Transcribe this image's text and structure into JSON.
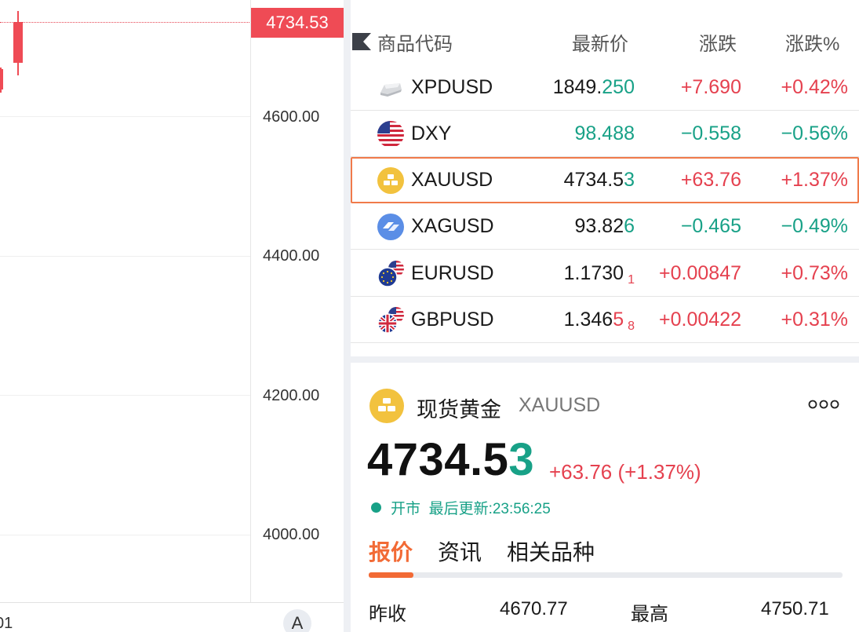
{
  "chart": {
    "current_price_tag": "4734.53",
    "y_axis_labels": [
      "4600.00",
      "4400.00",
      "4200.00",
      "4000.00"
    ],
    "x_axis_label": "01",
    "auto_button": "A",
    "colors": {
      "up": "#ef4b55",
      "grid": "#efefef"
    }
  },
  "watchlist": {
    "headers": {
      "symbol": "商品代码",
      "price": "最新价",
      "change": "涨跌",
      "change_pct": "涨跌%"
    },
    "rows": [
      {
        "icon": "palladium-icon",
        "symbol": "XPDUSD",
        "price_main": "1849.",
        "price_tail": "250",
        "price_tail_dir": "down",
        "price_sub": "",
        "change": "+7.690",
        "pct": "+0.42%",
        "dir": "up"
      },
      {
        "icon": "us-flag-icon",
        "symbol": "DXY",
        "price_main": "",
        "price_tail": "98.488",
        "price_tail_dir": "down",
        "price_sub": "",
        "change": "−0.558",
        "pct": "−0.56%",
        "dir": "down"
      },
      {
        "icon": "gold-icon",
        "symbol": "XAUUSD",
        "price_main": "4734.5",
        "price_tail": "3",
        "price_tail_dir": "down",
        "price_sub": "",
        "change": "+63.76",
        "pct": "+1.37%",
        "dir": "up",
        "selected": true
      },
      {
        "icon": "silver-icon",
        "symbol": "XAGUSD",
        "price_main": "93.82",
        "price_tail": "6",
        "price_tail_dir": "down",
        "price_sub": "",
        "change": "−0.465",
        "pct": "−0.49%",
        "dir": "down"
      },
      {
        "icon": "eu-us-flag-icon",
        "symbol": "EURUSD",
        "price_main": "1.1730",
        "price_tail": "",
        "price_tail_dir": "up",
        "price_sub": "1",
        "change": "+0.00847",
        "pct": "+0.73%",
        "dir": "up"
      },
      {
        "icon": "uk-us-flag-icon",
        "symbol": "GBPUSD",
        "price_main": "1.346",
        "price_tail": "5",
        "price_tail_dir": "up",
        "price_sub": "8",
        "change": "+0.00422",
        "pct": "+0.31%",
        "dir": "up"
      }
    ]
  },
  "detail": {
    "name": "现货黄金",
    "code": "XAUUSD",
    "price_main": "4734.5",
    "price_last": "3",
    "change": "+63.76 (+1.37%)",
    "status": "开市",
    "updated_label": "最后更新:23:56:25",
    "tabs": [
      "报价",
      "资讯",
      "相关品种"
    ],
    "active_tab": 0,
    "stats": {
      "prev_close_label": "昨收",
      "prev_close": "4670.77",
      "high_label": "最高",
      "high": "4750.71"
    }
  },
  "colors": {
    "accent": "#f26a35",
    "up": "#e5414f",
    "down": "#18a187",
    "gold": "#f2c23e"
  }
}
